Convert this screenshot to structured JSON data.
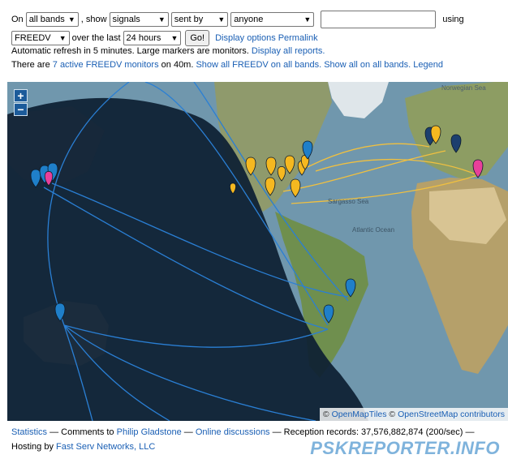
{
  "controls": {
    "on_label": "On",
    "band_select": "all bands",
    "show_label": ", show",
    "type_select": "signals",
    "direction_select": "sent by",
    "who_select": "anyone",
    "callsign_value": "",
    "using_label": "using",
    "mode_select": "FREEDV",
    "over_label": "over the last",
    "period_select": "24 hours",
    "go_label": "Go!",
    "display_options_link": "Display options",
    "permalink_link": "Permalink"
  },
  "status": {
    "refresh_text": "Automatic refresh in 5 minutes. Large markers are monitors.",
    "display_all_link": "Display all reports.",
    "monitors_prefix": "There are",
    "monitors_link": "7 active FREEDV monitors",
    "monitors_suffix": "on 40m.",
    "show_mode_all_link": "Show all FREEDV on all bands.",
    "show_all_link": "Show all on all bands.",
    "legend_link": "Legend"
  },
  "map": {
    "zoom_in": "+",
    "zoom_out": "−",
    "attribution_symbol_1": "©",
    "attribution_openmaptiles": "OpenMapTiles",
    "attribution_symbol_2": "©",
    "attribution_osm": "OpenStreetMap contributors",
    "labels": {
      "norwegian_sea": "Norwegian Sea",
      "sargasso_sea": "Sargasso Sea",
      "atlantic_ocean": "Atlantic Ocean"
    },
    "colors": {
      "marker_yellow": "#f5b820",
      "marker_blue": "#1f7fc9",
      "marker_navy": "#1c3f6e",
      "marker_pink": "#e8409a",
      "path_blue": "#2a7fd4",
      "path_yellow": "#f0c040"
    }
  },
  "footer": {
    "statistics_link": "Statistics",
    "comments_text": "— Comments to",
    "author_link": "Philip Gladstone",
    "dash1": "—",
    "discussions_link": "Online discussions",
    "records_text": "— Reception records: 37,576,882,874 (200/sec) —",
    "hosting_text": "Hosting by",
    "hosting_link": "Fast Serv Networks, LLC",
    "brand": "PSKREPORTER.INFO"
  }
}
